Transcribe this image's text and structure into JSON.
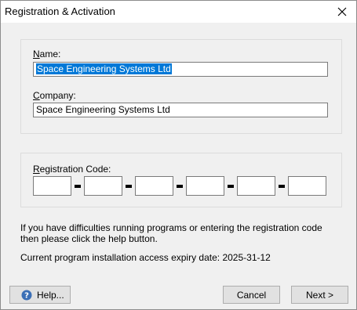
{
  "window": {
    "title": "Registration & Activation"
  },
  "name_field": {
    "label_underlined": "N",
    "label_rest": "ame:",
    "value": "Space Engineering Systems Ltd"
  },
  "company_field": {
    "label_underlined": "C",
    "label_rest": "ompany:",
    "value": "Space Engineering Systems Ltd"
  },
  "registration_code": {
    "label_underlined": "R",
    "label_rest": "egistration Code:",
    "segments": [
      "",
      "",
      "",
      "",
      "",
      ""
    ]
  },
  "info": {
    "help_text": "If you have difficulties running programs or entering the registration code then please click the help button.",
    "expiry_text": "Current program installation access expiry date: 2025-31-12"
  },
  "buttons": {
    "help": "Help...",
    "cancel": "Cancel",
    "next": "Next >"
  },
  "colors": {
    "selection": "#0078d7",
    "help_icon": "#3b6fb6"
  },
  "icons": {
    "close": "close-icon",
    "help": "help-icon"
  }
}
